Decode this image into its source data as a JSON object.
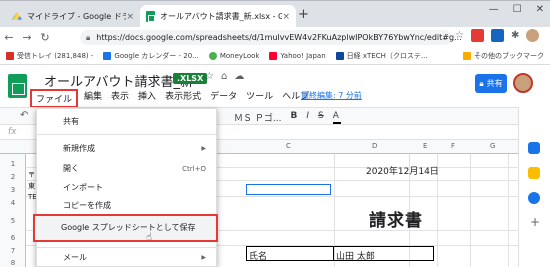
{
  "tabs": [
    {
      "title": "マイドライブ - Google ドライブ",
      "close": "×"
    },
    {
      "title": "オールアバウト請求書_新.xlsx - Google",
      "close": "×"
    }
  ],
  "new_tab": "+",
  "window_controls": {
    "minimize": "—",
    "maximize": "☐",
    "close": "✕"
  },
  "url": "https://docs.google.com/spreadsheets/d/1mulvvEW4v2FKuAzplwIPOkBY76YbwYnc/edit#g...",
  "bookmarks": [
    {
      "label": "受信トレイ (281,848) -",
      "color": "#d93025"
    },
    {
      "label": "Google カレンダー - 20...",
      "color": "#1a73e8"
    },
    {
      "label": "MoneyLook",
      "color": "#4caf50"
    },
    {
      "label": "Yahoo! Japan",
      "color": "#ff0033"
    },
    {
      "label": "日経 xTECH（クロステ...",
      "color": "#0d47a1"
    }
  ],
  "other_bookmarks": "その他のブックマーク",
  "doc": {
    "title": "オールアバウト請求書_新",
    "badge": ".XLSX",
    "last_edit": "最終編集: 7 分前",
    "share": "共有"
  },
  "menubar": [
    "ファイル",
    "編集",
    "表示",
    "挿入",
    "表示形式",
    "データ",
    "ツール",
    "ヘルプ"
  ],
  "toolbar": {
    "font": "ＭＳ Ｐゴ...",
    "bold": "B",
    "italic": "I",
    "strike": "S",
    "color": "A",
    "undo": "↶"
  },
  "formula_label": "fx",
  "columns": [
    "C",
    "D",
    "E",
    "F",
    "G"
  ],
  "rows": [
    "1",
    "2",
    "3",
    "4",
    "5",
    "6",
    "7",
    "8"
  ],
  "cells": {
    "date": "2020年12月14日",
    "invoice": "請求書",
    "name_label": "氏名",
    "name_value": "山田 太郎",
    "left_fragments": [
      "〒",
      "東",
      "TE"
    ]
  },
  "file_menu": {
    "items": [
      {
        "label": "共有",
        "shortcut": "",
        "arrow": false
      },
      {
        "label": "新規作成",
        "shortcut": "",
        "arrow": true
      },
      {
        "label": "開く",
        "shortcut": "Ctrl+O",
        "arrow": false
      },
      {
        "label": "インポート",
        "shortcut": "",
        "arrow": false
      },
      {
        "label": "コピーを作成",
        "shortcut": "",
        "arrow": false
      },
      {
        "label": "Google スプレッドシートとして保存",
        "shortcut": "",
        "arrow": false
      },
      {
        "label": "メール",
        "shortcut": "",
        "arrow": true
      }
    ]
  },
  "colors": {
    "accent": "#1a73e8",
    "sheets_green": "#0f9d58",
    "highlight_red": "#e53935"
  }
}
